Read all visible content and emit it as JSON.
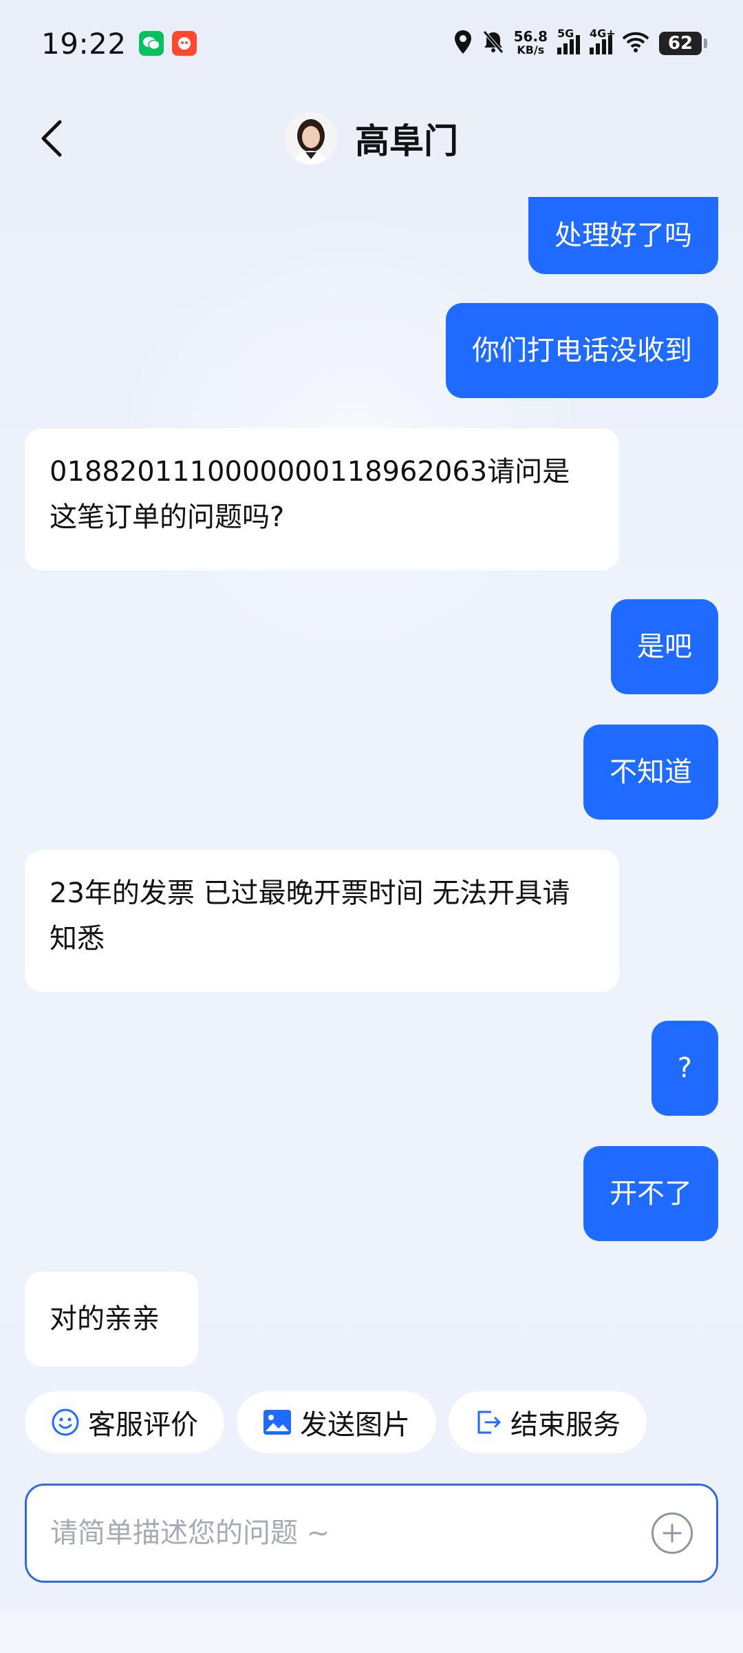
{
  "status_bar": {
    "time": "19:22",
    "net_speed": "56.8",
    "net_unit": "KB/s",
    "sim1_label": "5G",
    "sim2_label": "4G+",
    "battery": "62"
  },
  "header": {
    "title": "高阜门"
  },
  "messages": [
    {
      "side": "out",
      "text": "处理好了吗"
    },
    {
      "side": "out",
      "text": "你们打电话没收到"
    },
    {
      "side": "in",
      "text": "0188201110000000118962063请问是这笔订单的问题吗?"
    },
    {
      "side": "out",
      "text": "是吧"
    },
    {
      "side": "out",
      "text": "不知道"
    },
    {
      "side": "in",
      "text": "23年的发票 已过最晚开票时间 无法开具请知悉"
    },
    {
      "side": "out",
      "text": "?"
    },
    {
      "side": "out",
      "text": "开不了"
    },
    {
      "side": "in",
      "text": "对的亲亲"
    }
  ],
  "quick_actions": [
    {
      "label": "客服评价",
      "icon": "smile-icon"
    },
    {
      "label": "发送图片",
      "icon": "image-icon"
    },
    {
      "label": "结束服务",
      "icon": "exit-icon"
    }
  ],
  "input": {
    "placeholder": "请简单描述您的问题 ~",
    "value": ""
  },
  "colors": {
    "accent": "#1f6bff",
    "input_border": "#2f6bdf",
    "background": "#edf1fb"
  }
}
